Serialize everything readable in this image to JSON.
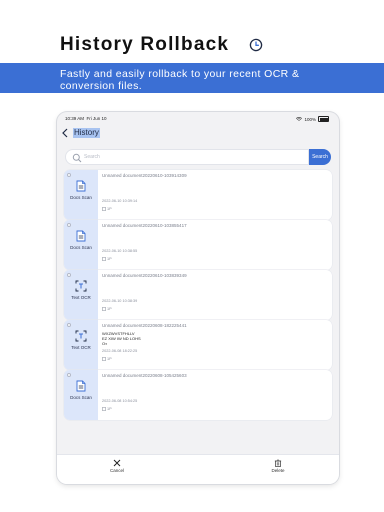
{
  "promo": {
    "title": "History Rollback",
    "subtitle": "Fastly and easily rollback to your recent OCR & conversion files.",
    "accent": "#3b6fd4"
  },
  "status": {
    "time": "10:39 AM",
    "date": "Fri Jun 10",
    "battery": "100%"
  },
  "nav": {
    "title": "History"
  },
  "search": {
    "placeholder": "Search",
    "button": "Search"
  },
  "items": [
    {
      "name": "Unnamed document20220610-103914309",
      "date": "2022-06-10 10:39:14",
      "pages": "1P",
      "type": "Docs Scan",
      "icon": "document-icon",
      "preview": []
    },
    {
      "name": "Unnamed document20220610-103855417",
      "date": "2022-06-10 10:38:55",
      "pages": "1P",
      "type": "Docs Scan",
      "icon": "document-icon",
      "preview": []
    },
    {
      "name": "Unnamed document20220610-103839349",
      "date": "2022-06-10 10:38:39",
      "pages": "1P",
      "type": "Text OCR",
      "icon": "text-scan-icon",
      "preview": []
    },
    {
      "name": "Unnamed document20220608-182225441",
      "date": "2022-06-08 18:22:25",
      "pages": "1P",
      "type": "Text OCR",
      "icon": "text-scan-icon",
      "preview": [
        "WXZWVSTFHLLV",
        "EZ XIW IW ND LOHS",
        "O◐"
      ]
    },
    {
      "name": "Unnamed document20220608-105425603",
      "date": "2022-06-08 10:54:25",
      "pages": "1P",
      "type": "Docs Scan",
      "icon": "document-icon",
      "preview": []
    }
  ],
  "toolbar": {
    "cancel": "Cancel",
    "delete": "Delete"
  }
}
